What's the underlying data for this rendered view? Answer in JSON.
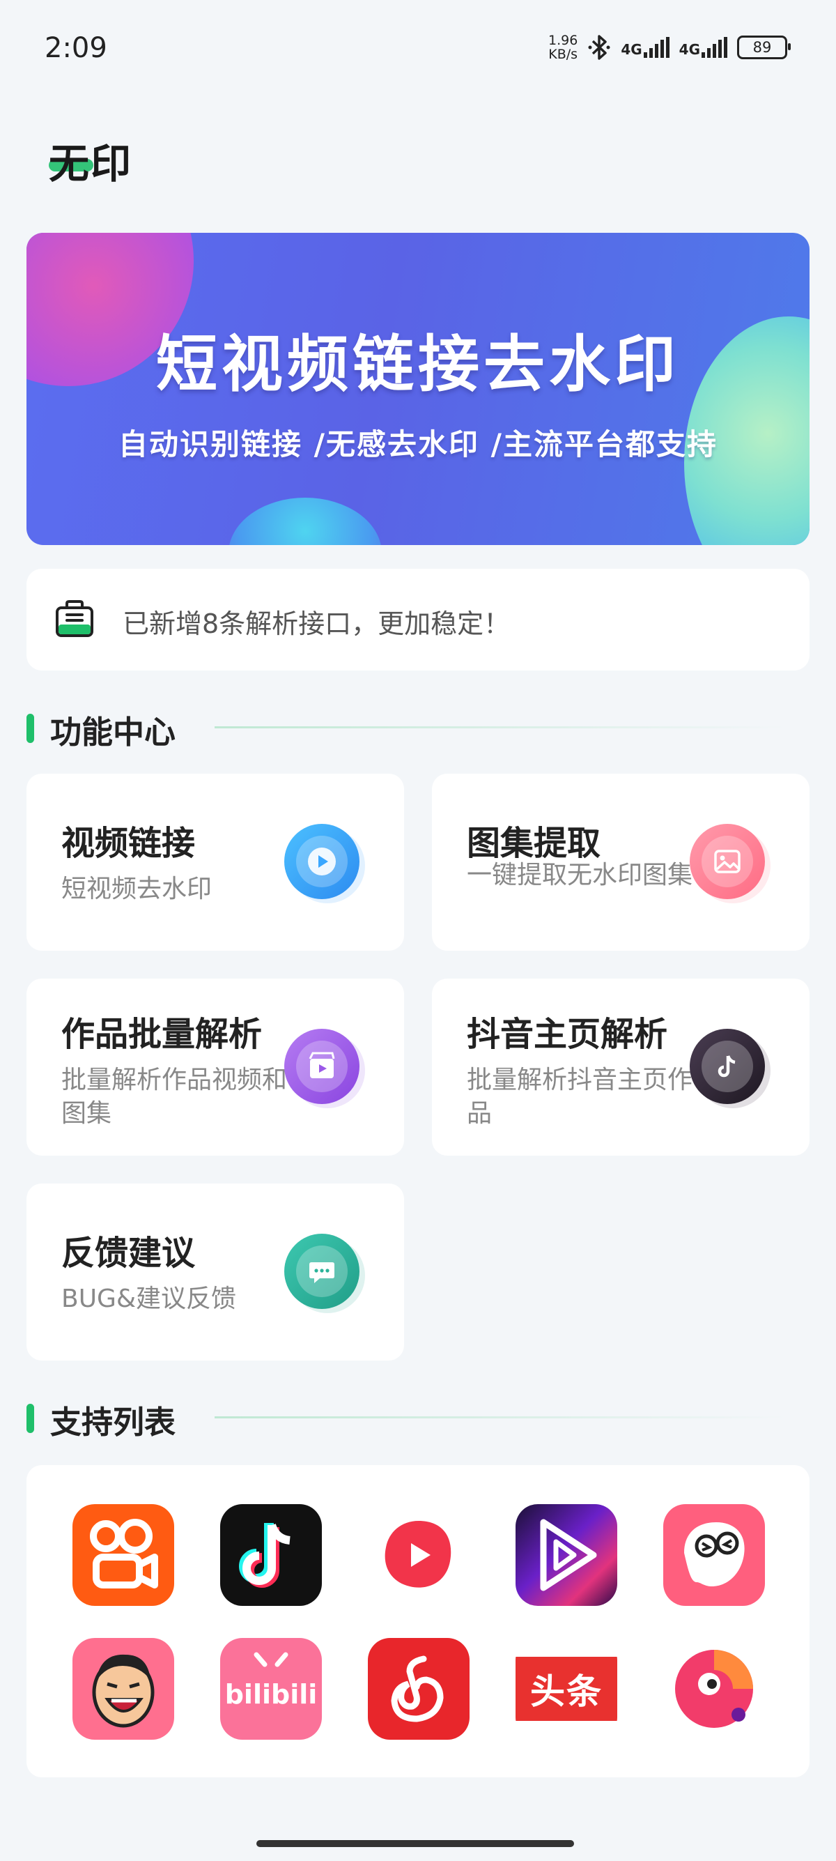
{
  "status_bar": {
    "time": "2:09",
    "net_speed_value": "1.96",
    "net_speed_unit": "KB/s",
    "sim1_label": "4G",
    "sim2_label": "4G",
    "battery_level": "89"
  },
  "header": {
    "app_title": "无印"
  },
  "banner": {
    "title": "短视频链接去水印",
    "subtitle": "自动识别链接 /无感去水印 /主流平台都支持"
  },
  "notice": {
    "text": "已新增8条解析接口，更加稳定！"
  },
  "sections": {
    "features_title": "功能中心",
    "supported_title": "支持列表"
  },
  "features": [
    {
      "title": "视频链接",
      "subtitle": "短视频去水印",
      "icon": "play-icon",
      "color": "#3aa7ff"
    },
    {
      "title": "图集提取",
      "subtitle": "一键提取无水印图集",
      "icon": "image-icon",
      "color": "#ff7e92"
    },
    {
      "title": "作品批量解析",
      "subtitle": "批量解析作品视频和图集",
      "icon": "clapper-icon",
      "color": "#9b59e8"
    },
    {
      "title": "抖音主页解析",
      "subtitle": "批量解析抖音主页作品",
      "icon": "tiktok-icon",
      "color": "#2a2230"
    },
    {
      "title": "反馈建议",
      "subtitle": "BUG&建议反馈",
      "icon": "chat-icon",
      "color": "#2bb39a"
    }
  ],
  "supported_apps": [
    {
      "name": "kuaishou-icon",
      "color": "#ff5b12"
    },
    {
      "name": "douyin-icon",
      "color": "#111111"
    },
    {
      "name": "weishi-icon",
      "color": "#f2344a"
    },
    {
      "name": "haokan-icon",
      "color": "#5a23c8"
    },
    {
      "name": "pipixia-icon",
      "color": "#ff5f7e"
    },
    {
      "name": "zuiyou-icon",
      "color": "#ff6f8f"
    },
    {
      "name": "bilibili-icon",
      "color": "#fb7299"
    },
    {
      "name": "netease-music-icon",
      "color": "#e8262b"
    },
    {
      "name": "toutiao-icon",
      "color": "#e8312f",
      "label": "头条"
    },
    {
      "name": "pipigaoxiao-icon",
      "color": "#f23c6a"
    }
  ]
}
